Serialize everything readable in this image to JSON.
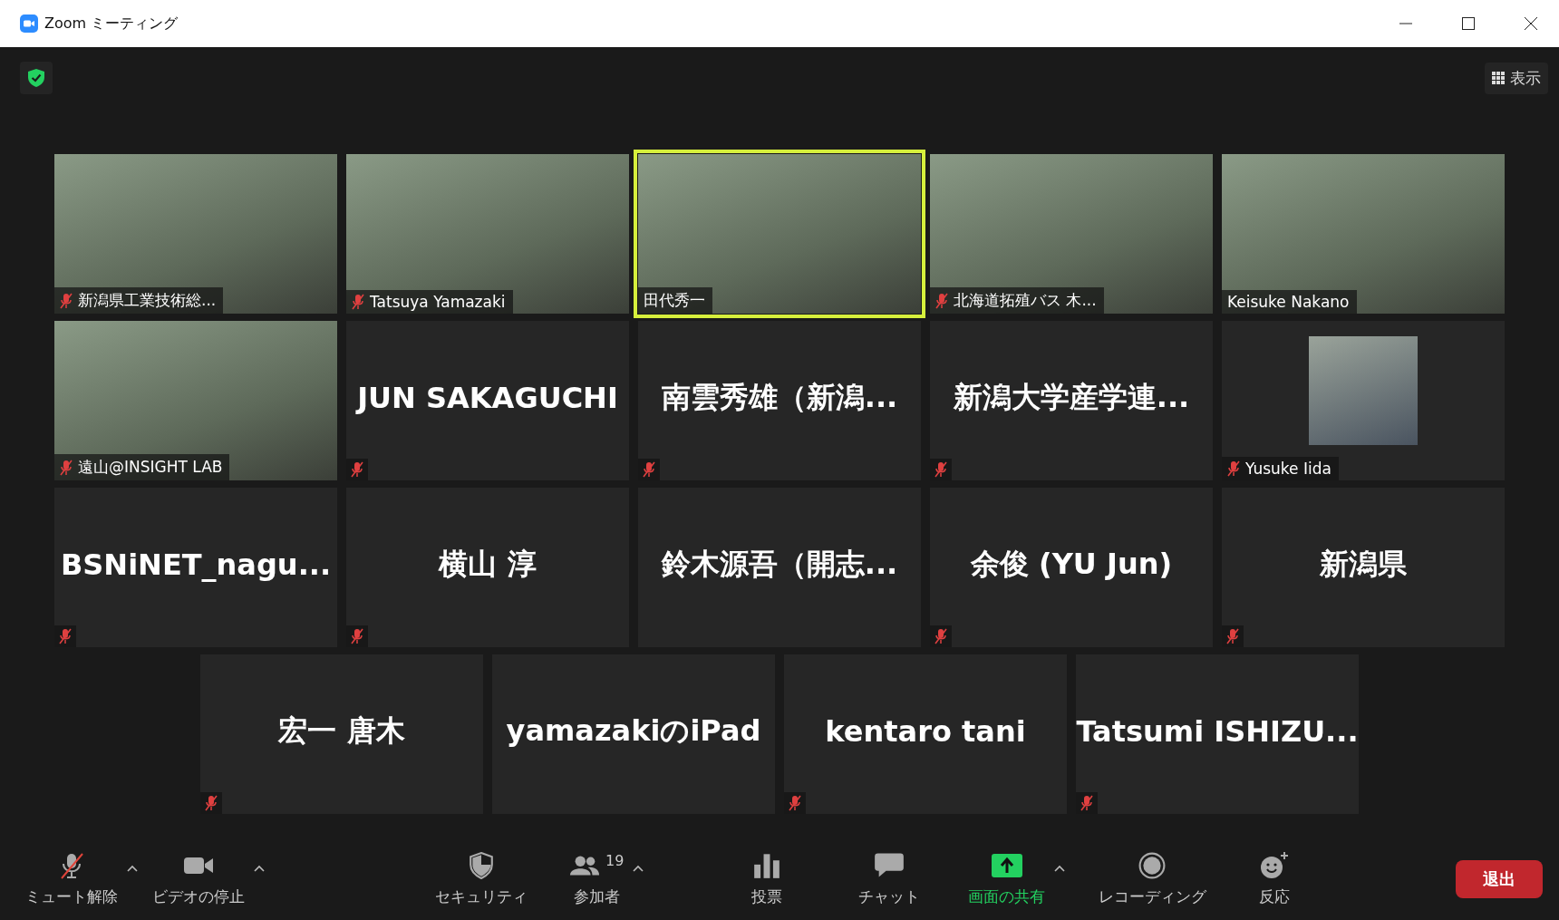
{
  "window": {
    "title": "Zoom ミーティング"
  },
  "view_button": {
    "label": "表示"
  },
  "tiles": [
    {
      "kind": "video",
      "name": "新潟県工業技術総...",
      "muted": true,
      "speaking": false
    },
    {
      "kind": "video",
      "name": "Tatsuya Yamazaki",
      "muted": true,
      "speaking": false
    },
    {
      "kind": "video",
      "name": "田代秀一",
      "muted": false,
      "speaking": true
    },
    {
      "kind": "video",
      "name": "北海道拓殖バス 木...",
      "muted": true,
      "speaking": false
    },
    {
      "kind": "video",
      "name": "Keisuke Nakano",
      "muted": false,
      "speaking": false
    },
    {
      "kind": "video",
      "name": "遠山@INSIGHT LAB",
      "muted": true,
      "speaking": false
    },
    {
      "kind": "name",
      "name": "JUN SAKAGUCHI",
      "muted": true,
      "speaking": false
    },
    {
      "kind": "name",
      "name": "南雲秀雄（新潟...",
      "muted": true,
      "speaking": false
    },
    {
      "kind": "name",
      "name": "新潟大学産学連...",
      "muted": true,
      "speaking": false
    },
    {
      "kind": "picture",
      "name": "Yusuke Iida",
      "muted": true,
      "speaking": false
    },
    {
      "kind": "name",
      "name": "BSNiNET_nagu...",
      "muted": true,
      "speaking": false
    },
    {
      "kind": "name",
      "name": "横山 淳",
      "muted": true,
      "speaking": false
    },
    {
      "kind": "name",
      "name": "鈴木源吾（開志...",
      "muted": false,
      "speaking": false
    },
    {
      "kind": "name",
      "name": "余俊 (YU Jun)",
      "muted": true,
      "speaking": false
    },
    {
      "kind": "name",
      "name": "新潟県",
      "muted": true,
      "speaking": false
    },
    {
      "kind": "name",
      "name": "宏一 唐木",
      "muted": true,
      "speaking": false
    },
    {
      "kind": "name",
      "name": "yamazakiのiPad",
      "muted": false,
      "speaking": false
    },
    {
      "kind": "name",
      "name": "kentaro tani",
      "muted": true,
      "speaking": false
    },
    {
      "kind": "name",
      "name": "Tatsumi  ISHIZU...",
      "muted": true,
      "speaking": false
    }
  ],
  "toolbar": [
    {
      "kind": "mic",
      "label": "ミュート解除",
      "caret": true,
      "highlight": false
    },
    {
      "kind": "video",
      "label": "ビデオの停止",
      "caret": true,
      "highlight": false
    },
    {
      "kind": "security",
      "label": "セキュリティ",
      "caret": false,
      "highlight": false
    },
    {
      "kind": "participants",
      "label": "参加者",
      "count": "19",
      "caret": true,
      "highlight": false
    },
    {
      "kind": "polls",
      "label": "投票",
      "caret": false,
      "highlight": false
    },
    {
      "kind": "chat",
      "label": "チャット",
      "caret": false,
      "highlight": false
    },
    {
      "kind": "share",
      "label": "画面の共有",
      "caret": true,
      "highlight": true
    },
    {
      "kind": "record",
      "label": "レコーディング",
      "caret": false,
      "highlight": false
    },
    {
      "kind": "reactions",
      "label": "反応",
      "caret": false,
      "highlight": false
    }
  ],
  "leave_button": {
    "label": "退出"
  }
}
